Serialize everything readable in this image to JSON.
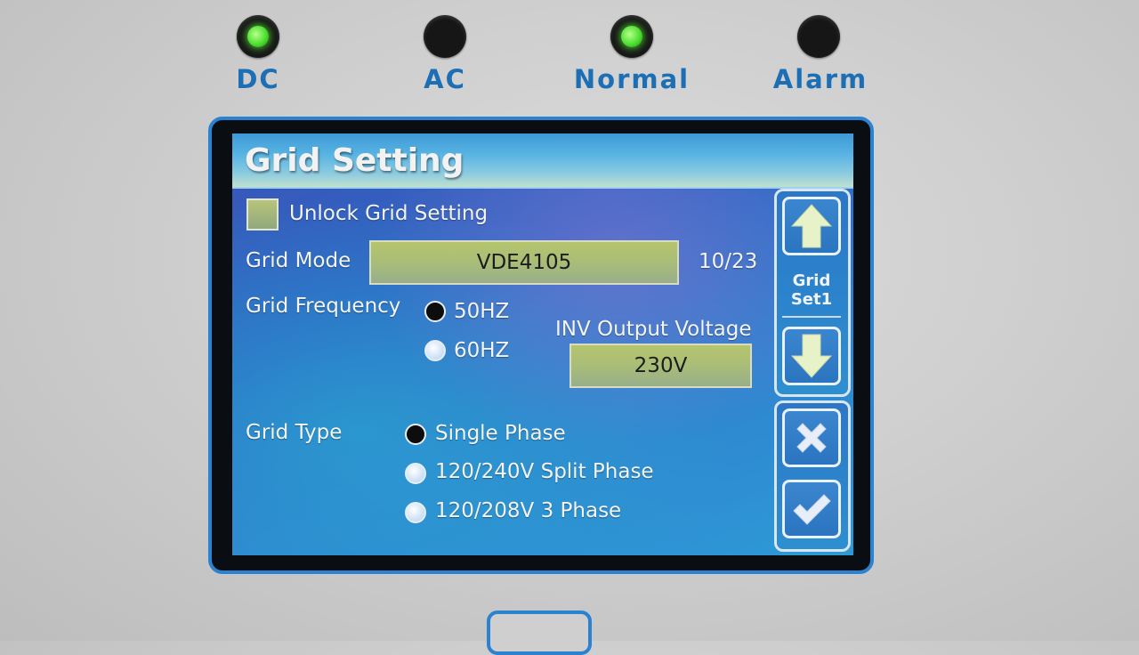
{
  "indicators": [
    {
      "label": "DC",
      "state": "on"
    },
    {
      "label": "AC",
      "state": "off"
    },
    {
      "label": "Normal",
      "state": "on"
    },
    {
      "label": "Alarm",
      "state": "off"
    }
  ],
  "screen": {
    "title": "Grid Setting",
    "unlock_label": "Unlock Grid Setting",
    "unlock_checked": false,
    "grid_mode": {
      "label": "Grid Mode",
      "value": "VDE4105",
      "counter": "10/23"
    },
    "grid_frequency": {
      "label": "Grid Frequency",
      "options": [
        "50HZ",
        "60HZ"
      ],
      "selected": "50HZ"
    },
    "inv_output_voltage": {
      "label": "INV Output Voltage",
      "value": "230V"
    },
    "grid_type": {
      "label": "Grid Type",
      "options": [
        "Single Phase",
        "120/240V Split Phase",
        "120/208V 3 Phase"
      ],
      "selected": "Single Phase"
    },
    "side_panel": {
      "page_label_line1": "Grid",
      "page_label_line2": "Set1",
      "icons": [
        "arrow-up-icon",
        "arrow-down-icon",
        "close-icon",
        "check-icon"
      ]
    }
  },
  "colors": {
    "accent_blue": "#1d6fb5",
    "led_green": "#4ee031",
    "field_green": "#a9bd78"
  }
}
